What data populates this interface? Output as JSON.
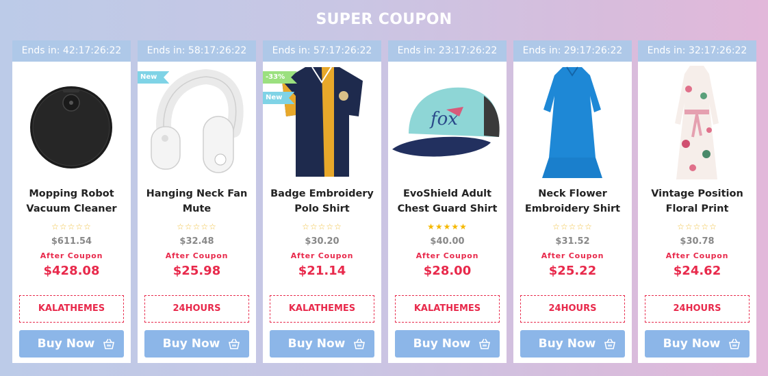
{
  "section": {
    "title": "SUPER COUPON"
  },
  "colors": {
    "accent": "#e8294b",
    "button": "#8cb6e8",
    "timer_bar": "#aec8e8",
    "tag_new": "#7fd3e6",
    "tag_sale": "#9be07f"
  },
  "products": [
    {
      "timer": "Ends in: 42:17:26:22",
      "name": "Mopping Robot Vacuum Cleaner",
      "stars": "☆☆☆☆☆",
      "old_price": "$611.54",
      "after_label": "After Coupon",
      "new_price": "$428.08",
      "coupon_code": "KALATHEMES",
      "buy_label": "Buy Now",
      "image_icon": "robot-vacuum-icon"
    },
    {
      "timer": "Ends in: 58:17:26:22",
      "name": "Hanging Neck Fan Mute",
      "stars": "☆☆☆☆☆",
      "old_price": "$32.48",
      "after_label": "After Coupon",
      "new_price": "$25.98",
      "coupon_code": "24HOURS",
      "buy_label": "Buy Now",
      "image_icon": "neck-fan-icon",
      "tags": {
        "new": "New"
      }
    },
    {
      "timer": "Ends in: 57:17:26:22",
      "name": "Badge Embroidery Polo Shirt",
      "stars": "☆☆☆☆☆",
      "old_price": "$30.20",
      "after_label": "After Coupon",
      "new_price": "$21.14",
      "coupon_code": "KALATHEMES",
      "buy_label": "Buy Now",
      "image_icon": "polo-shirt-icon",
      "tags": {
        "sale": "-33%",
        "new": "New"
      }
    },
    {
      "timer": "Ends in: 23:17:26:22",
      "name": "EvoShield Adult Chest Guard Shirt",
      "stars": "★★★★★",
      "old_price": "$40.00",
      "after_label": "After Coupon",
      "new_price": "$28.00",
      "coupon_code": "KALATHEMES",
      "buy_label": "Buy Now",
      "image_icon": "cap-icon",
      "rating": 5
    },
    {
      "timer": "Ends in: 29:17:26:22",
      "name": "Neck Flower Embroidery Shirt",
      "stars": "☆☆☆☆☆",
      "old_price": "$31.52",
      "after_label": "After Coupon",
      "new_price": "$25.22",
      "coupon_code": "24HOURS",
      "buy_label": "Buy Now",
      "image_icon": "blue-dress-icon"
    },
    {
      "timer": "Ends in: 32:17:26:22",
      "name": "Vintage Position Floral Print",
      "stars": "☆☆☆☆☆",
      "old_price": "$30.78",
      "after_label": "After Coupon",
      "new_price": "$24.62",
      "coupon_code": "24HOURS",
      "buy_label": "Buy Now",
      "image_icon": "floral-dress-icon"
    }
  ]
}
